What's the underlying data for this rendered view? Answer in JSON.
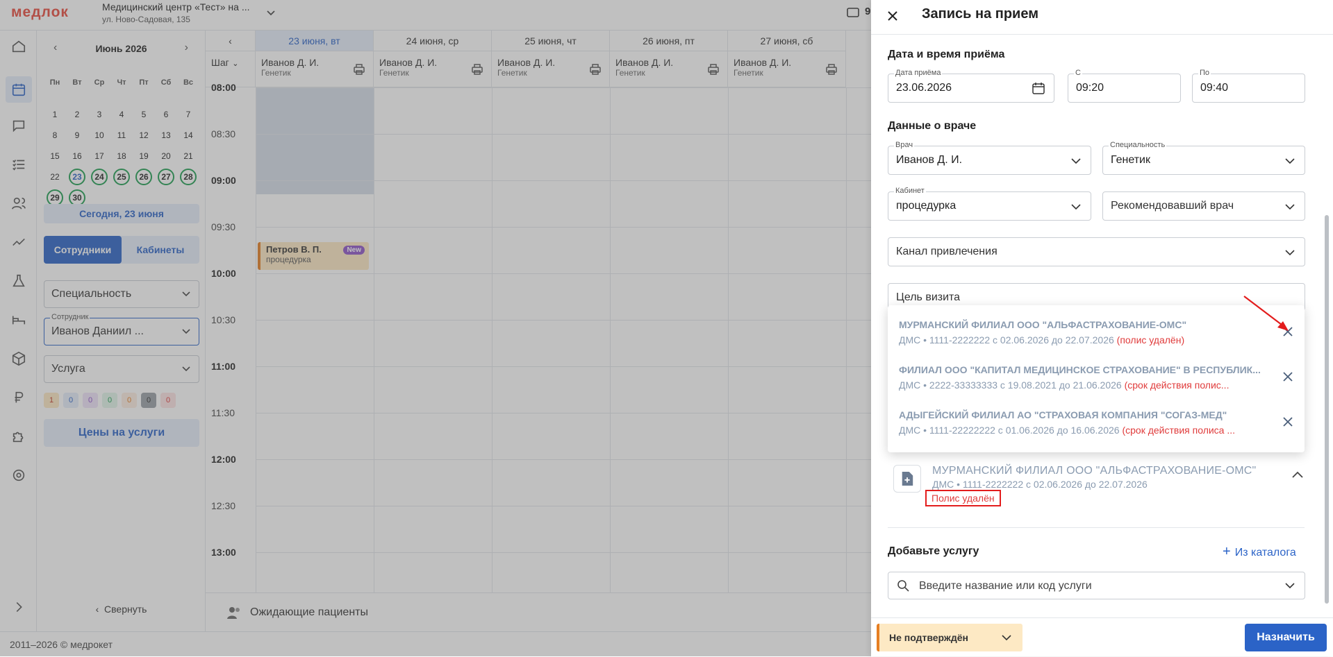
{
  "app": {
    "logo": "медлок",
    "clinic_name": "Медицинский центр «Тест» на ...",
    "clinic_address": "ул. Ново-Садовая, 135",
    "footer": "2011–2026 © медрокет",
    "top_right_badge": "9"
  },
  "calendar": {
    "month": "Июнь 2026",
    "weekdays": [
      "Пн",
      "Вт",
      "Ср",
      "Чт",
      "Пт",
      "Сб",
      "Вс"
    ],
    "weeks": [
      [
        "1",
        "2",
        "3",
        "4",
        "5",
        "6",
        "7"
      ],
      [
        "8",
        "9",
        "10",
        "11",
        "12",
        "13",
        "14"
      ],
      [
        "15",
        "16",
        "17",
        "18",
        "19",
        "20",
        "21"
      ],
      [
        "22",
        "23",
        "24",
        "25",
        "26",
        "27",
        "28"
      ],
      [
        "29",
        "30",
        "",
        "",
        "",
        "",
        ""
      ]
    ],
    "today_button": "Сегодня, 23 июня",
    "tab_employees": "Сотрудники",
    "tab_rooms": "Кабинеты",
    "specialty_placeholder": "Специальность",
    "employee_label": "Сотрудник",
    "employee_value": "Иванов Даниил ...",
    "service_placeholder": "Услуга",
    "badges": [
      "1",
      "0",
      "0",
      "0",
      "0",
      "0",
      "0"
    ],
    "prices_button": "Цены на услуги",
    "collapse_label": "Свернуть"
  },
  "schedule": {
    "step_label": "Шаг",
    "days": [
      "23 июня, вт",
      "24 июня, ср",
      "25 июня, чт",
      "26 июня, пт",
      "27 июня, сб"
    ],
    "doctor_name": "Иванов Д. И.",
    "doctor_spec": "Генетик",
    "times": [
      "08:00",
      "08:30",
      "09:00",
      "09:30",
      "10:00",
      "10:30",
      "11:00",
      "11:30",
      "12:00",
      "12:30",
      "13:00"
    ],
    "event": {
      "name": "Петров В. П.",
      "room": "процедурка",
      "badge": "New"
    },
    "waiting": "Ожидающие пациенты"
  },
  "panel": {
    "title": "Запись на прием",
    "section_datetime": "Дата и время приёма",
    "date_label": "Дата приёма",
    "date_value": "23.06.2026",
    "from_label": "С",
    "from_value": "09:20",
    "to_label": "По",
    "to_value": "09:40",
    "section_doctor": "Данные о враче",
    "doctor_label": "Врач",
    "doctor_value": "Иванов Д. И.",
    "spec_label": "Специальность",
    "spec_value": "Генетик",
    "room_label": "Кабинет",
    "room_value": "процедурка",
    "referrer_placeholder": "Рекомендовавший врач",
    "channel_placeholder": "Канал привлечения",
    "visit_goal_placeholder": "Цель визита",
    "policies": [
      {
        "title": "МУРМАНСКИЙ ФИЛИАЛ ООО \"АЛЬФАСТРАХОВАНИЕ-ОМС\"",
        "sub": "ДМС • 1111-2222222 с 02.06.2026 до 22.07.2026",
        "status": "(полис удалён)"
      },
      {
        "title": "ФИЛИАЛ ООО \"КАПИТАЛ МЕДИЦИНСКОЕ СТРАХОВАНИЕ\" В РЕСПУБЛИК...",
        "sub": "ДМС • 2222-33333333 с 19.08.2021 до 21.06.2026",
        "status": "(срок действия полис..."
      },
      {
        "title": "АДЫГЕЙСКИЙ ФИЛИАЛ АО \"СТРАХОВАЯ КОМПАНИЯ \"СОГАЗ-МЕД\"",
        "sub": "ДМС • 1111-22222222 с 01.06.2026 до 16.06.2026",
        "status": "(срок действия полиса ..."
      }
    ],
    "selected_policy": {
      "title": "МУРМАНСКИЙ ФИЛИАЛ ООО \"АЛЬФАСТРАХОВАНИЕ-ОМС\"",
      "sub": "ДМС • 1111-2222222 с 02.06.2026 до 22.07.2026",
      "deleted": "Полис удалён"
    },
    "section_service": "Добавьте услугу",
    "catalog_link": "Из каталога",
    "service_search_placeholder": "Введите название или код услуги",
    "status_value": "Не подтверждён",
    "assign_button": "Назначить"
  },
  "colors": {
    "accent": "#2b63c7",
    "brand": "#e84a3c",
    "danger": "#e31c1c",
    "success": "#1e9e52"
  }
}
